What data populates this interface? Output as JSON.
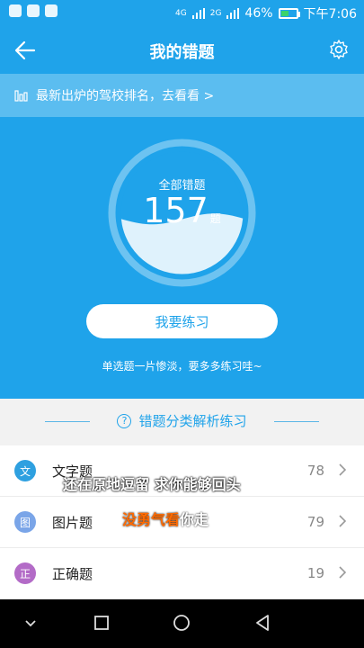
{
  "status": {
    "signal1": "4G",
    "signal2": "2G",
    "battery": "46%",
    "time": "下午7:06"
  },
  "appbar": {
    "title": "我的错题"
  },
  "banner": {
    "text": "最新出炉的驾校排名，去看看 >"
  },
  "summary": {
    "label": "全部错题",
    "count": "157",
    "unit": "题",
    "fill_ratio": 0.45
  },
  "cta": {
    "label": "我要练习"
  },
  "tip": "单选题一片惨淡，要多多练习哇~",
  "section": {
    "title": "错题分类解析练习"
  },
  "categories": [
    {
      "badge": "文",
      "name": "文字题",
      "count": "78",
      "color": "#2ea0e0"
    },
    {
      "badge": "图",
      "name": "图片题",
      "count": "79",
      "color": "#7aa5e8"
    },
    {
      "badge": "正",
      "name": "正确题",
      "count": "19",
      "color": "#b36bc7"
    }
  ],
  "overlay": {
    "line1": "还在原地逗留 求你能够回头",
    "line2_highlight": "没勇气看",
    "line2_rest": "你走"
  },
  "colors": {
    "primary": "#1fa3ea",
    "banner": "#5bbdf0"
  }
}
